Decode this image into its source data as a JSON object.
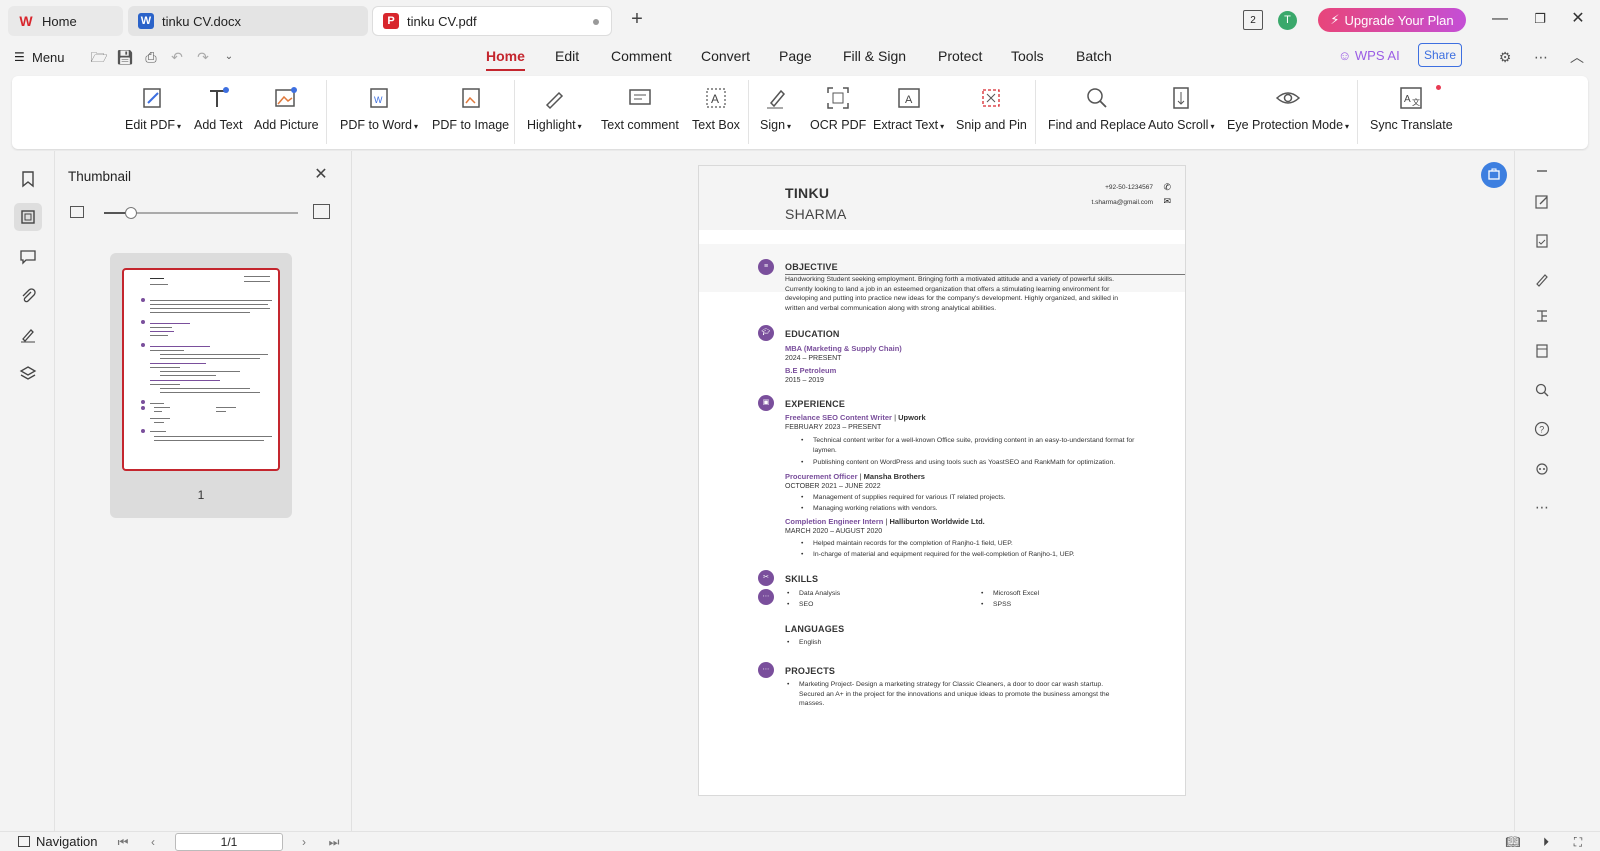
{
  "tabs": {
    "home": "Home",
    "docx": "tinku CV.docx",
    "pdf": "tinku CV.pdf"
  },
  "header": {
    "upgrade": "Upgrade Your Plan",
    "avatar_letter": "T",
    "page_count_badge": "2"
  },
  "menubar": {
    "menu_label": "Menu",
    "tabs": [
      "Home",
      "Edit",
      "Comment",
      "Convert",
      "Page",
      "Fill & Sign",
      "Protect",
      "Tools",
      "Batch"
    ],
    "active_tab": "Home",
    "wps_ai": "WPS AI",
    "share": "Share"
  },
  "ribbon": {
    "edit_pdf": "Edit PDF",
    "add_text": "Add Text",
    "add_picture": "Add Picture",
    "pdf_to_word": "PDF to Word",
    "pdf_to_image": "PDF to Image",
    "highlight": "Highlight",
    "text_comment": "Text comment",
    "text_box": "Text Box",
    "sign": "Sign",
    "ocr_pdf": "OCR PDF",
    "extract_text": "Extract Text",
    "snip_and_pin": "Snip and Pin",
    "find_and_replace": "Find and Replace",
    "auto_scroll": "Auto Scroll",
    "eye_protection": "Eye Protection Mode",
    "sync_translate": "Sync Translate"
  },
  "thumbnail": {
    "title": "Thumbnail",
    "page_label": "1",
    "zoom_fraction": 0.14
  },
  "document": {
    "first_name": "TINKU",
    "last_name": "SHARMA",
    "phone": "+92-50-1234567",
    "email": "t.sharma@gmail.com",
    "objective_title": "OBJECTIVE",
    "objective_text": "Handworking Student seeking employment. Bringing forth a motivated attitude and a variety of powerful skills. Currently looking to land a job in an esteemed organization that offers a stimulating learning environment for developing and putting into practice new ideas for the company's development. Highly organized, and skilled in written and verbal communication along with strong analytical abilities.",
    "education_title": "EDUCATION",
    "edu1_degree": "MBA (Marketing & Supply Chain)",
    "edu1_dates": "2024 – PRESENT",
    "edu2_degree": "B.E Petroleum",
    "edu2_dates": "2015 – 2019",
    "experience_title": "EXPERIENCE",
    "job1_role": "Freelance SEO Content Writer",
    "job1_sep": " | ",
    "job1_org": "Upwork",
    "job1_dates": "FEBRUARY 2023 – PRESENT",
    "job1_b1": "Technical content writer for a well-known Office suite, providing content in an easy-to-understand format for laymen.",
    "job1_b2": "Publishing content on WordPress and using tools such as YoastSEO and RankMath for optimization.",
    "job2_role": "Procurement Officer",
    "job2_sep": " | ",
    "job2_org": "Mansha Brothers",
    "job2_dates": "OCTOBER 2021 – JUNE 2022",
    "job2_b1": "Management of supplies required for various IT related projects.",
    "job2_b2": "Managing working relations with vendors.",
    "job3_role": "Completion Engineer Intern",
    "job3_sep": " | ",
    "job3_org": "Halliburton Worldwide Ltd.",
    "job3_dates": "MARCH 2020 – AUGUST 2020",
    "job3_b1": "Helped maintain records for the completion of Ranjho-1 field, UEP.",
    "job3_b2": "In-charge of material and equipment required for the well-completion of Ranjho-1, UEP.",
    "skills_title": "SKILLS",
    "skill1": "Data Analysis",
    "skill2": "SEO",
    "skill3": "Microsoft Excel",
    "skill4": "SPSS",
    "languages_title": "LANGUAGES",
    "language1": "English",
    "projects_title": "PROJECTS",
    "project1": "Marketing Project- Design a marketing strategy for Classic Cleaners, a door to door car wash startup. Secured an A+ in the project for the innovations and unique ideas to promote the business amongst the masses."
  },
  "statusbar": {
    "navigation": "Navigation",
    "page_indicator": "1/1"
  },
  "colors": {
    "accent_red": "#c4262e",
    "resume_purple": "#7a4f9c",
    "share_blue": "#3d6fe0"
  }
}
